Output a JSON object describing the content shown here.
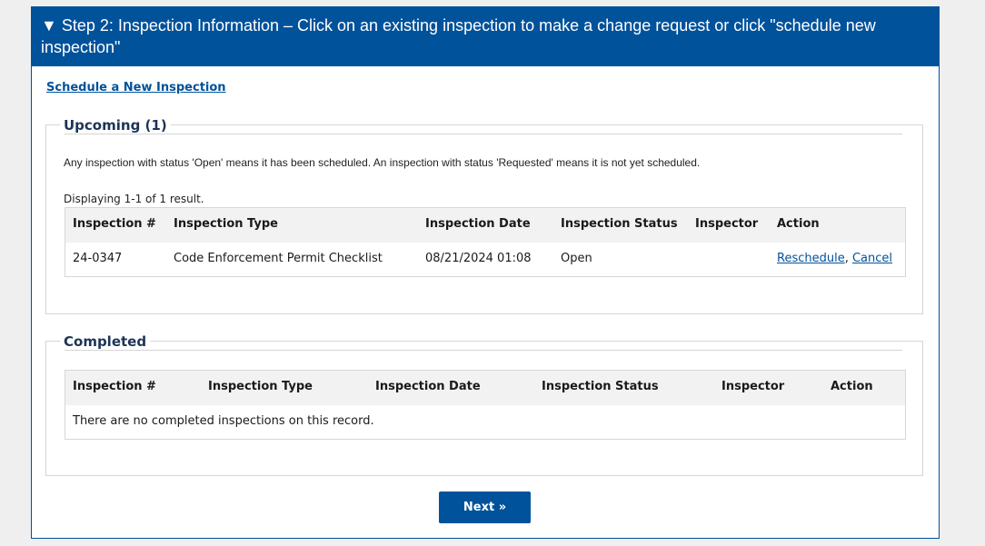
{
  "header": {
    "arrow": "▼",
    "title": "Step 2: Inspection Information – Click on an existing inspection to make a change request or click \"schedule new inspection\""
  },
  "schedule_link": "Schedule a New Inspection",
  "upcoming": {
    "title": "Upcoming (1)",
    "note": "Any inspection with status 'Open' means it has been scheduled. An inspection with status 'Requested' means it is not yet scheduled.",
    "count": "Displaying 1-1 of 1 result.",
    "columns": [
      "Inspection #",
      "Inspection Type",
      "Inspection Date",
      "Inspection Status",
      "Inspector",
      "Action"
    ],
    "rows": [
      {
        "number": "24-0347",
        "type": "Code Enforcement Permit Checklist",
        "date": "08/21/2024 01:08",
        "status": "Open",
        "inspector": "",
        "action_reschedule": "Reschedule",
        "action_sep": ", ",
        "action_cancel": "Cancel"
      }
    ]
  },
  "completed": {
    "title": "Completed",
    "columns": [
      "Inspection #",
      "Inspection Type",
      "Inspection Date",
      "Inspection Status",
      "Inspector",
      "Action"
    ],
    "empty": "There are no completed inspections on this record."
  },
  "next_label": "Next »"
}
